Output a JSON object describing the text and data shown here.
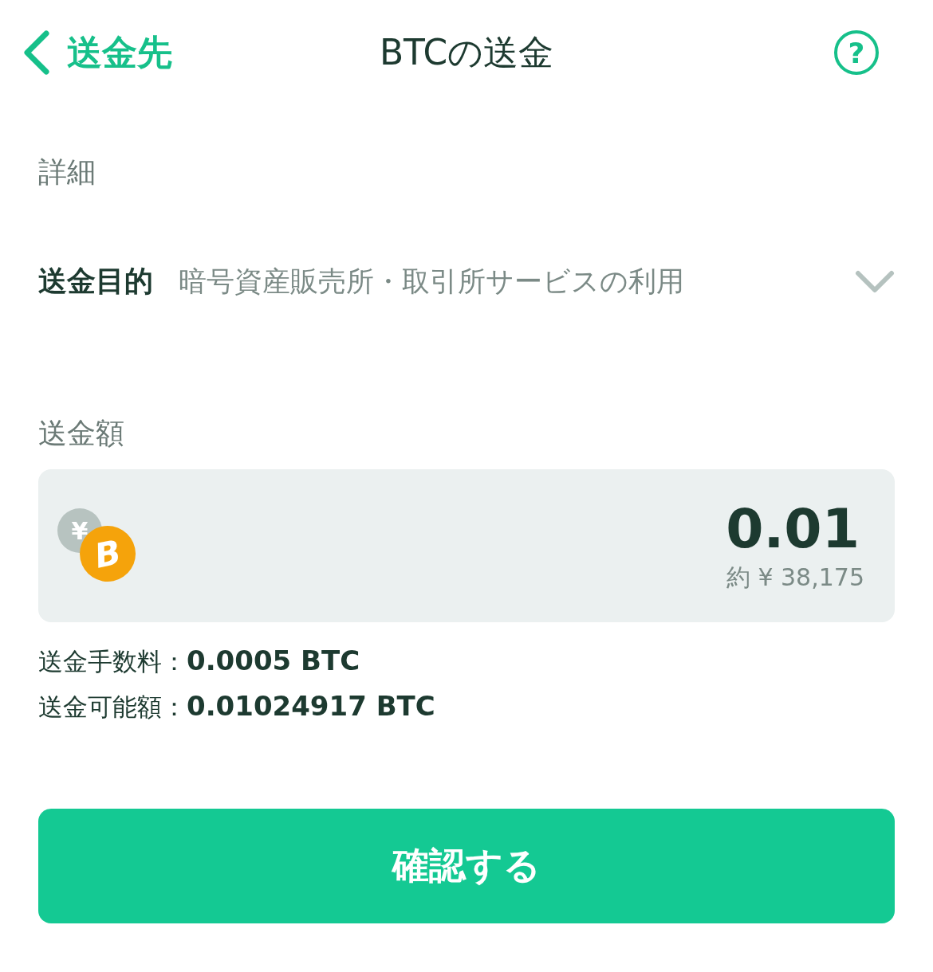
{
  "header": {
    "back_label": "送金先",
    "title": "BTCの送金",
    "help_icon": "?"
  },
  "details": {
    "heading": "詳細",
    "purpose_label": "送金目的",
    "purpose_value": "暗号資産販売所・取引所サービスの利用"
  },
  "amount": {
    "heading": "送金額",
    "coin_marks": [
      "¥",
      "B"
    ],
    "value": "0.01",
    "approx": "約 ¥ 38,175"
  },
  "fees": [
    {
      "label": "送金手数料：",
      "value": "0.0005 BTC"
    },
    {
      "label": "送金可能額：",
      "value": "0.01024917 BTC"
    }
  ],
  "confirm_button": "確認する"
}
